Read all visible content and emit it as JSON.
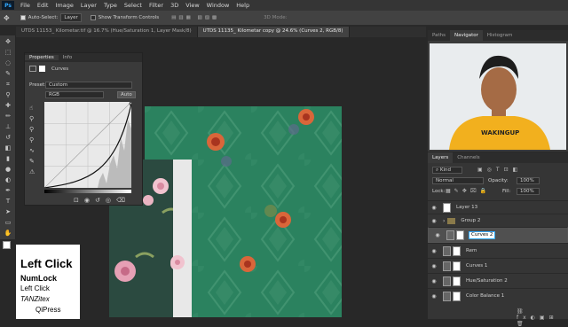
{
  "menubar": {
    "logo": "Ps",
    "items": [
      "File",
      "Edit",
      "Image",
      "Layer",
      "Type",
      "Select",
      "Filter",
      "3D",
      "View",
      "Window",
      "Help"
    ]
  },
  "options": {
    "auto_select_label": "Auto-Select:",
    "auto_select_value": "Layer",
    "transform_label": "Show Transform Controls",
    "mode_label": "3D Mode:"
  },
  "tabs": [
    "UTDS 11153_ Kilometar.tif @ 16.7% (Hue/Saturation 1, Layer Mask/8)",
    "UTDS 11135_ Kilometar copy @ 24.6% (Curves 2, RGB/8)"
  ],
  "properties": {
    "tabs": [
      "Properties",
      "Info"
    ],
    "type_label": "Curves",
    "preset_label": "Preset:",
    "preset_value": "Custom",
    "channel_value": "RGB",
    "auto_label": "Auto"
  },
  "navigator": {
    "tabs": [
      "Paths",
      "Navigator",
      "Histogram"
    ],
    "webcam_text": "WAKINGUP"
  },
  "layers": {
    "tabs": [
      "Layers",
      "Channels"
    ],
    "kind_label": "Kind",
    "blend_mode": "Normal",
    "opacity_label": "Opacity:",
    "opacity_value": "100%",
    "lock_label": "Lock:",
    "fill_label": "Fill:",
    "fill_value": "100%",
    "items": [
      {
        "name": "Layer 13",
        "kind": "pixel",
        "selected": false
      },
      {
        "name": "Group 2",
        "kind": "group",
        "selected": false
      },
      {
        "name": "Curves 2",
        "kind": "adjust",
        "selected": true
      },
      {
        "name": "Rem",
        "kind": "adjust",
        "selected": false
      },
      {
        "name": "Curves 1",
        "kind": "adjust",
        "selected": false
      },
      {
        "name": "Hue/Saturation 2",
        "kind": "adjust",
        "selected": false
      },
      {
        "name": "Color Balance 1",
        "kind": "adjust",
        "selected": false
      }
    ]
  },
  "keys_overlay": {
    "line1": "Left Click",
    "line2": "NumLock",
    "line3": "Left Click",
    "line4": "TANZitex",
    "line5": "QiPress"
  },
  "colors": {
    "accent": "#31a8ff",
    "fabric": "#2f8a66",
    "shirt": "#f2b01e"
  }
}
